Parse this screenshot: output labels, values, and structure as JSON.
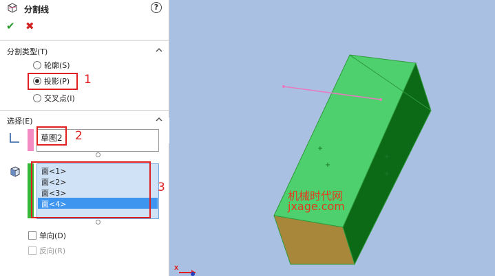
{
  "header": {
    "title": "分割线",
    "help_label": "?",
    "ok_glyph": "✔",
    "cancel_glyph": "✖"
  },
  "split_type": {
    "title": "分割类型(T)",
    "options": [
      {
        "label": "轮廓(S)",
        "selected": false
      },
      {
        "label": "投影(P)",
        "selected": true
      },
      {
        "label": "交叉点(I)",
        "selected": false
      }
    ]
  },
  "selection": {
    "title": "选择(E)",
    "sketch_value": "草图2",
    "faces": [
      "面<1>",
      "面<2>",
      "面<3>",
      "面<4>"
    ],
    "selected_face": "面<4>",
    "single_direction": "单向(D)",
    "reverse": "反向(R)"
  },
  "annotations": [
    "1",
    "2",
    "3"
  ],
  "watermark": {
    "line1": "机械时代网",
    "line2": "jxage.com"
  },
  "triad": {
    "x_label": "X"
  },
  "colors": {
    "sketch_bar": "#f28cc3",
    "face_bar": "#35b835",
    "annotation": "#e02020",
    "viewport_bg": "#a9c0e2"
  }
}
